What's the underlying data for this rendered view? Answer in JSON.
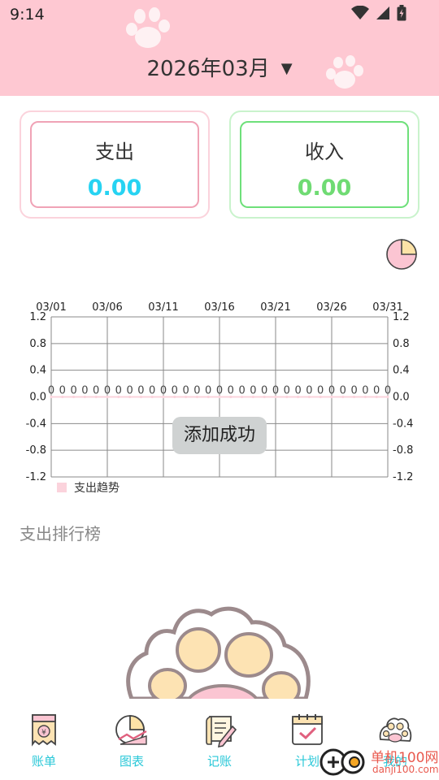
{
  "status_bar": {
    "time": "9:14"
  },
  "header": {
    "month": "2026年03月"
  },
  "summary": {
    "expense": {
      "label": "支出",
      "value": "0.00"
    },
    "income": {
      "label": "收入",
      "value": "0.00"
    }
  },
  "chart_data": {
    "type": "line",
    "x_tick_labels": [
      "03/01",
      "03/06",
      "03/11",
      "03/16",
      "03/21",
      "03/26",
      "03/31"
    ],
    "y_tick_labels": [
      "1.2",
      "0.8",
      "0.4",
      "0.0",
      "-0.4",
      "-0.8",
      "-1.2"
    ],
    "ylim": [
      -1.2,
      1.2
    ],
    "grid": true,
    "legend_position": "bottom-left",
    "series": [
      {
        "name": "支出趋势",
        "color": "#fbd3dc",
        "x": [
          "03/01",
          "03/02",
          "03/03",
          "03/04",
          "03/05",
          "03/06",
          "03/07",
          "03/08",
          "03/09",
          "03/10",
          "03/11",
          "03/12",
          "03/13",
          "03/14",
          "03/15",
          "03/16",
          "03/17",
          "03/18",
          "03/19",
          "03/20",
          "03/21",
          "03/22",
          "03/23",
          "03/24",
          "03/25",
          "03/26",
          "03/27",
          "03/28",
          "03/29",
          "03/30",
          "03/31"
        ],
        "values": [
          0,
          0,
          0,
          0,
          0,
          0,
          0,
          0,
          0,
          0,
          0,
          0,
          0,
          0,
          0,
          0,
          0,
          0,
          0,
          0,
          0,
          0,
          0,
          0,
          0,
          0,
          0,
          0,
          0,
          0,
          0
        ],
        "data_labels": [
          "0",
          "0",
          "0",
          "0",
          "0",
          "0",
          "0",
          "0",
          "0",
          "0",
          "0",
          "0",
          "0",
          "0",
          "0",
          "0",
          "0",
          "0",
          "0",
          "0",
          "0",
          "0",
          "0",
          "0",
          "0",
          "0",
          "0",
          "0",
          "0",
          "0",
          "0"
        ]
      }
    ]
  },
  "ranking": {
    "title": "支出排行榜"
  },
  "toast": {
    "text": "添加成功"
  },
  "nav": {
    "items": [
      {
        "label": "账单"
      },
      {
        "label": "图表"
      },
      {
        "label": "记账"
      },
      {
        "label": "计划"
      },
      {
        "label": "我的"
      }
    ]
  },
  "watermark": {
    "text": "单机100网",
    "sub": "danji100.com"
  },
  "colors": {
    "header_bg": "#fec8d2",
    "expense_accent": "#27d3f2",
    "income_accent": "#6fdb73",
    "nav_label": "#2ac8d8"
  }
}
